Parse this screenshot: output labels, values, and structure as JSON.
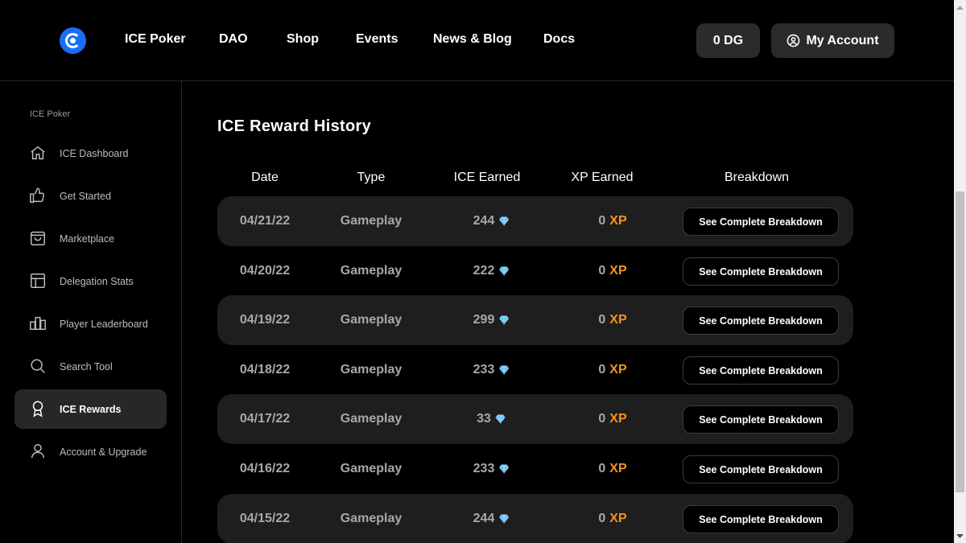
{
  "nav": {
    "links": [
      "ICE Poker",
      "DAO",
      "Shop",
      "Events",
      "News & Blog",
      "Docs"
    ],
    "dg_balance": "0 DG",
    "account_label": "My Account"
  },
  "sidebar": {
    "heading": "ICE Poker",
    "items": [
      {
        "label": "ICE Dashboard",
        "icon": "home-icon"
      },
      {
        "label": "Get Started",
        "icon": "thumbs-up-icon"
      },
      {
        "label": "Marketplace",
        "icon": "shopping-bag-icon"
      },
      {
        "label": "Delegation Stats",
        "icon": "layout-icon"
      },
      {
        "label": "Player Leaderboard",
        "icon": "bar-chart-icon"
      },
      {
        "label": "Search Tool",
        "icon": "search-icon"
      },
      {
        "label": "ICE Rewards",
        "icon": "award-icon",
        "active": true
      },
      {
        "label": "Account & Upgrade",
        "icon": "user-icon"
      }
    ]
  },
  "page": {
    "title": "ICE Reward History",
    "columns": [
      "Date",
      "Type",
      "ICE Earned",
      "XP Earned",
      "Breakdown"
    ],
    "xp_unit": "XP",
    "button_label": "See Complete Breakdown",
    "rows": [
      {
        "date": "04/21/22",
        "type": "Gameplay",
        "ice": "244",
        "xp": "0"
      },
      {
        "date": "04/20/22",
        "type": "Gameplay",
        "ice": "222",
        "xp": "0"
      },
      {
        "date": "04/19/22",
        "type": "Gameplay",
        "ice": "299",
        "xp": "0"
      },
      {
        "date": "04/18/22",
        "type": "Gameplay",
        "ice": "233",
        "xp": "0"
      },
      {
        "date": "04/17/22",
        "type": "Gameplay",
        "ice": "33",
        "xp": "0"
      },
      {
        "date": "04/16/22",
        "type": "Gameplay",
        "ice": "233",
        "xp": "0"
      },
      {
        "date": "04/15/22",
        "type": "Gameplay",
        "ice": "244",
        "xp": "0"
      }
    ]
  },
  "colors": {
    "background": "#000000",
    "row_shade": "#1e1e1e",
    "xp_accent": "#f6931a",
    "gem": "#8fd8ff",
    "logo": "#1a6ef5"
  }
}
